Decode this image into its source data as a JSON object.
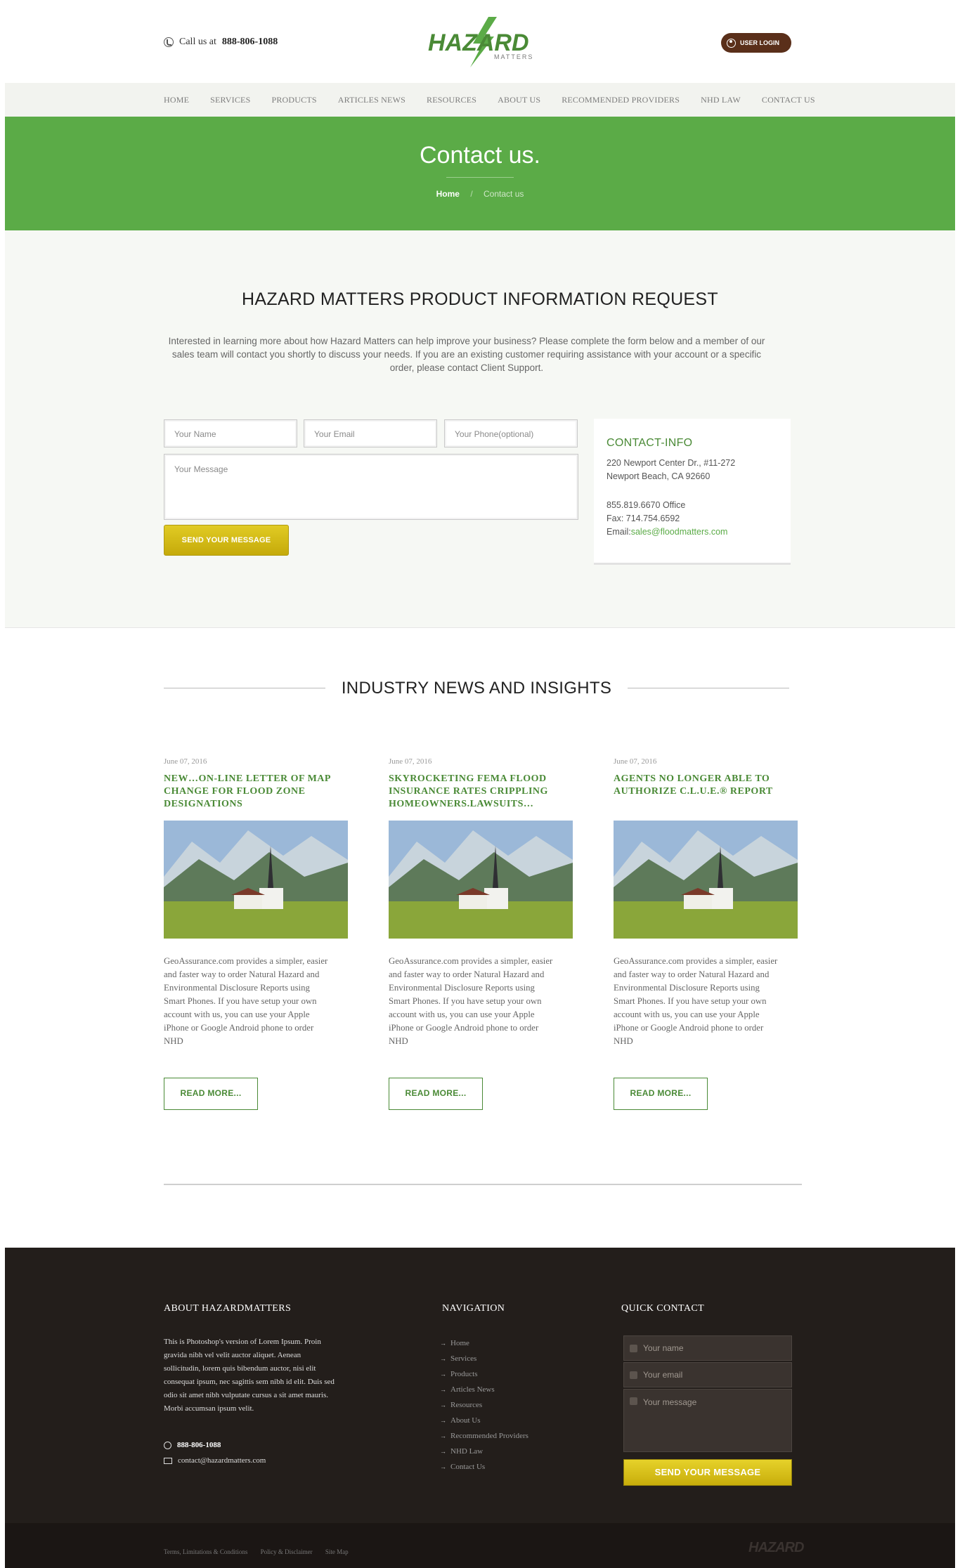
{
  "header": {
    "call_prefix": "Call us at",
    "call_number": "888-806-1088",
    "logo_text": "HAZARD",
    "logo_sub": "MATTERS",
    "login_label": "USER LOGIN"
  },
  "nav": {
    "items": [
      "HOME",
      "SERVICES",
      "PRODUCTS",
      "ARTICLES NEWS",
      "RESOURCES",
      "ABOUT US",
      "RECOMMENDED PROVIDERS",
      "NHD LAW",
      "CONTACT US"
    ]
  },
  "hero": {
    "title": "Contact us.",
    "crumb_home": "Home",
    "crumb_sep": "/",
    "crumb_current": "Contact us"
  },
  "request": {
    "heading": "HAZARD MATTERS PRODUCT INFORMATION REQUEST",
    "intro": "Interested in learning more about how Hazard Matters can help improve your business? Please complete the form below and a member of our sales team will contact you shortly to discuss your needs. If you are an existing customer requiring assistance with your account or a specific order, please contact Client Support.",
    "name_placeholder": "Your Name",
    "email_placeholder": "Your Email",
    "phone_placeholder": "Your Phone(optional)",
    "message_placeholder": "Your Message",
    "send_label": "SEND YOUR MESSAGE"
  },
  "contact_info": {
    "title": "CONTACT-INFO",
    "address1": "220 Newport Center Dr., #11-272",
    "address2": "Newport Beach, CA 92660",
    "office": "855.819.6670 Office",
    "fax": "Fax: 714.754.6592",
    "email_label": "Email:",
    "email": "sales@floodmatters.com"
  },
  "news": {
    "heading": "INDUSTRY NEWS AND INSIGHTS",
    "cards": [
      {
        "date": "June 07, 2016",
        "title": "NEW…ON-LINE LETTER OF MAP CHANGE FOR FLOOD ZONE DESIGNATIONS",
        "body": "GeoAssurance.com provides a simpler, easier and faster way to order Natural Hazard and Environmental Disclosure Reports using Smart Phones. If you have setup your own account with us, you can use your Apple iPhone or Google Android phone to order NHD",
        "more": "READ MORE..."
      },
      {
        "date": "June 07, 2016",
        "title": "SKYROCKETING FEMA FLOOD INSURANCE RATES CRIPPLING HOMEOWNERS.LAWSUITS…",
        "body": "GeoAssurance.com provides a simpler, easier and faster way to order Natural Hazard and Environmental Disclosure Reports using Smart Phones. If you have setup your own account with us, you can use your Apple iPhone or Google Android phone to order NHD",
        "more": "READ MORE..."
      },
      {
        "date": "June 07, 2016",
        "title": "AGENTS NO LONGER ABLE TO AUTHORIZE C.L.U.E.® REPORT",
        "body": "GeoAssurance.com provides a simpler, easier and faster way to order Natural Hazard and Environmental Disclosure Reports using Smart Phones. If you have setup your own account with us, you can use your Apple iPhone or Google Android phone to order NHD",
        "more": "READ MORE..."
      }
    ]
  },
  "footer": {
    "about_title": "ABOUT HAZARDMATTERS",
    "about_text": "This is Photoshop's version of Lorem Ipsum. Proin gravida nibh vel velit auctor aliquet. Aenean sollicitudin, lorem quis bibendum auctor, nisi elit consequat ipsum, nec sagittis sem nibh id elit. Duis sed odio sit amet nibh vulputate cursus a sit amet mauris. Morbi accumsan ipsum velit.",
    "phone": "888-806-1088",
    "email": "contact@hazardmatters.com",
    "nav_title": "NAVIGATION",
    "nav_items": [
      "Home",
      "Services",
      "Products",
      "Articles News",
      "Resources",
      "About Us",
      "Recommended Providers",
      "NHD Law",
      "Contact Us"
    ],
    "quick_title": "QUICK CONTACT",
    "q_name": "Your name",
    "q_email": "Your email",
    "q_message": "Your message",
    "q_send": "SEND YOUR MESSAGE",
    "bottom_links": [
      "Terms, Limitations & Conditions",
      "Policy & Disclaimer",
      "Site Map"
    ],
    "bottom_logo": "HAZARD"
  },
  "colors": {
    "brand_green": "#5bab47",
    "title_green": "#4a8a36",
    "button_gold": "#d4bb16",
    "login_brown": "#5a2f1a",
    "footer_bg": "#231e1b"
  }
}
